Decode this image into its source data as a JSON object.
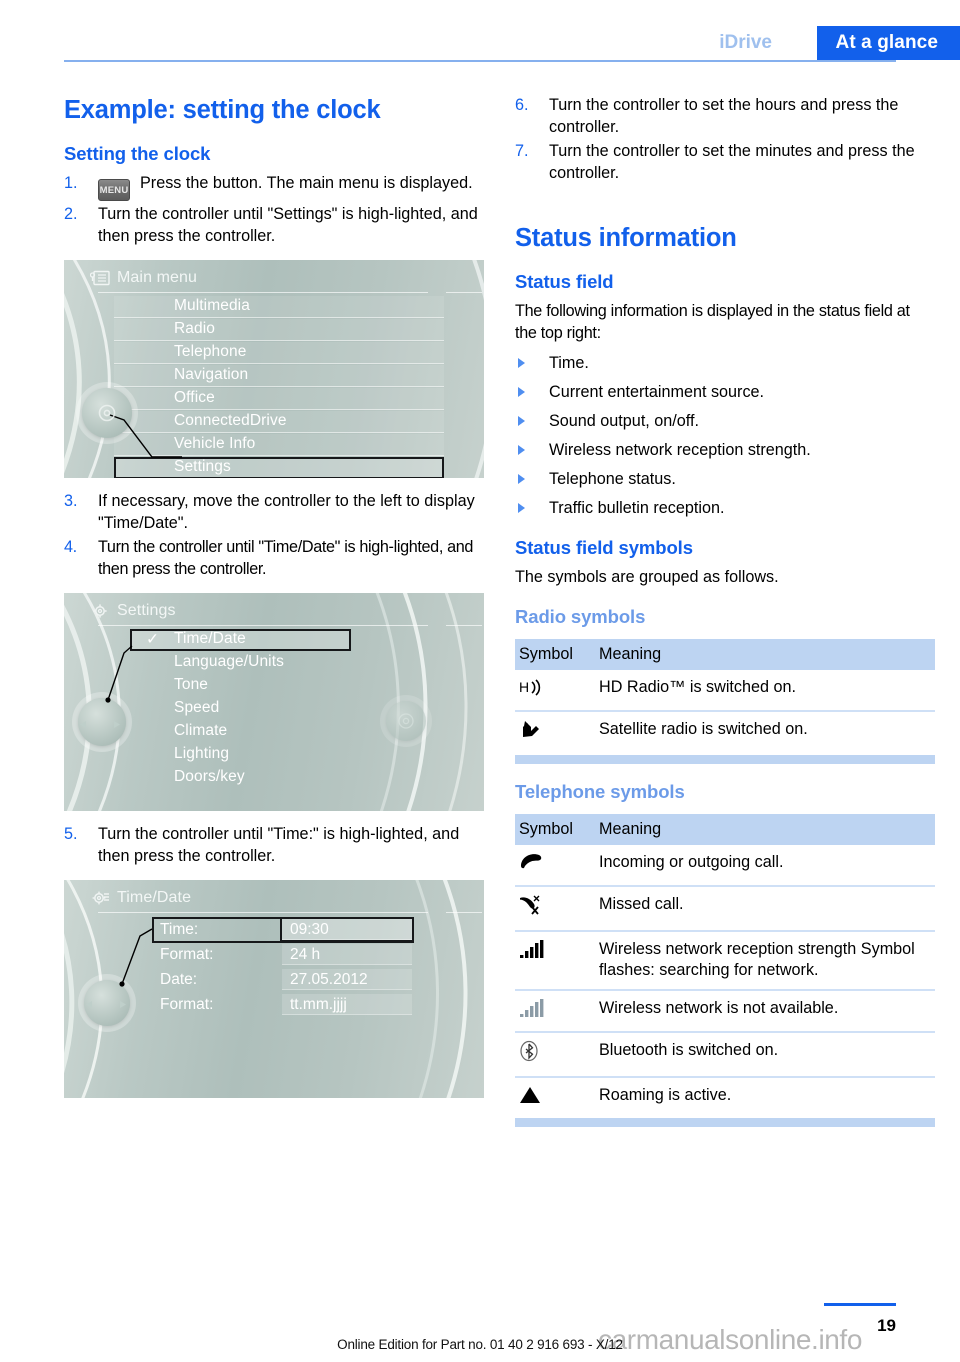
{
  "header": {
    "breadcrumb": "iDrive",
    "section": "At a glance"
  },
  "left": {
    "title": "Example: setting the clock",
    "subtitle": "Setting the clock",
    "steps": [
      {
        "num": "1.",
        "key": "MENU",
        "text": "Press the button. The main menu is displayed."
      },
      {
        "num": "2.",
        "text": "Turn the controller until \"Settings\" is high-lighted, and then press the controller."
      },
      {
        "num": "3.",
        "text": "If necessary, move the controller to the left to display \"Time/Date\"."
      },
      {
        "num": "4.",
        "text": "Turn the controller until \"Time/Date\" is high-lighted, and then press the controller."
      },
      {
        "num": "5.",
        "text": "Turn the controller until \"Time:\" is high-lighted, and then press the controller."
      }
    ],
    "screen_main_menu": {
      "title": "Main menu",
      "items": [
        "Multimedia",
        "Radio",
        "Telephone",
        "Navigation",
        "Office",
        "ConnectedDrive",
        "Vehicle Info",
        "Settings"
      ],
      "selected": "Settings"
    },
    "screen_settings": {
      "title": "Settings",
      "items": [
        "Time/Date",
        "Language/Units",
        "Tone",
        "Speed",
        "Climate",
        "Lighting",
        "Doors/key"
      ],
      "selected": "Time/Date",
      "checkmark": "✓"
    },
    "screen_time_date": {
      "title": "Time/Date",
      "rows": [
        {
          "label": "Time:",
          "value": "09:30",
          "selected": true
        },
        {
          "label": "Format:",
          "value": "24 h",
          "selected": false
        },
        {
          "label": "Date:",
          "value": "27.05.2012",
          "selected": false
        },
        {
          "label": "Format:",
          "value": "tt.mm.jjjj",
          "selected": false
        }
      ]
    }
  },
  "right": {
    "steps": [
      {
        "num": "6.",
        "text": "Turn the controller to set the hours and press the controller."
      },
      {
        "num": "7.",
        "text": "Turn the controller to set the minutes and press the controller."
      }
    ],
    "title": "Status information",
    "status_field_heading": "Status field",
    "status_field_intro": "The following information is displayed in the status field at the top right:",
    "status_field_items": [
      "Time.",
      "Current entertainment source.",
      "Sound output, on/off.",
      "Wireless network reception strength.",
      "Telephone status.",
      "Traffic bulletin reception."
    ],
    "symbols_heading": "Status field symbols",
    "symbols_intro": "The symbols are grouped as follows.",
    "radio_symbols": {
      "heading": "Radio symbols",
      "columns": [
        "Symbol",
        "Meaning"
      ],
      "rows": [
        {
          "icon": "hd-radio-icon",
          "glyph": "HD",
          "meaning": "HD Radio™ is switched on."
        },
        {
          "icon": "satellite-radio-icon",
          "glyph": "SAT",
          "meaning": "Satellite radio is switched on."
        }
      ]
    },
    "telephone_symbols": {
      "heading": "Telephone symbols",
      "columns": [
        "Symbol",
        "Meaning"
      ],
      "rows": [
        {
          "icon": "phone-handset-icon",
          "meaning": "Incoming or outgoing call."
        },
        {
          "icon": "missed-call-icon",
          "meaning": "Missed call."
        },
        {
          "icon": "signal-bars-icon",
          "meaning": "Wireless network reception strength Symbol flashes: searching for network."
        },
        {
          "icon": "signal-bars-unavailable-icon",
          "meaning": "Wireless network is not available."
        },
        {
          "icon": "bluetooth-icon",
          "meaning": "Bluetooth is switched on."
        },
        {
          "icon": "roaming-triangle-icon",
          "meaning": "Roaming is active."
        }
      ]
    }
  },
  "footer": {
    "edition_text": "Online Edition for Part no. 01 40 2 916 693 - X/12",
    "page_number": "19",
    "watermark": "carmanualsonline.info"
  },
  "colors": {
    "accent_blue": "#1260EB",
    "light_blue": "#6C9BE8",
    "table_header": "#BDD4F2",
    "table_rule": "#cfe0f6"
  }
}
